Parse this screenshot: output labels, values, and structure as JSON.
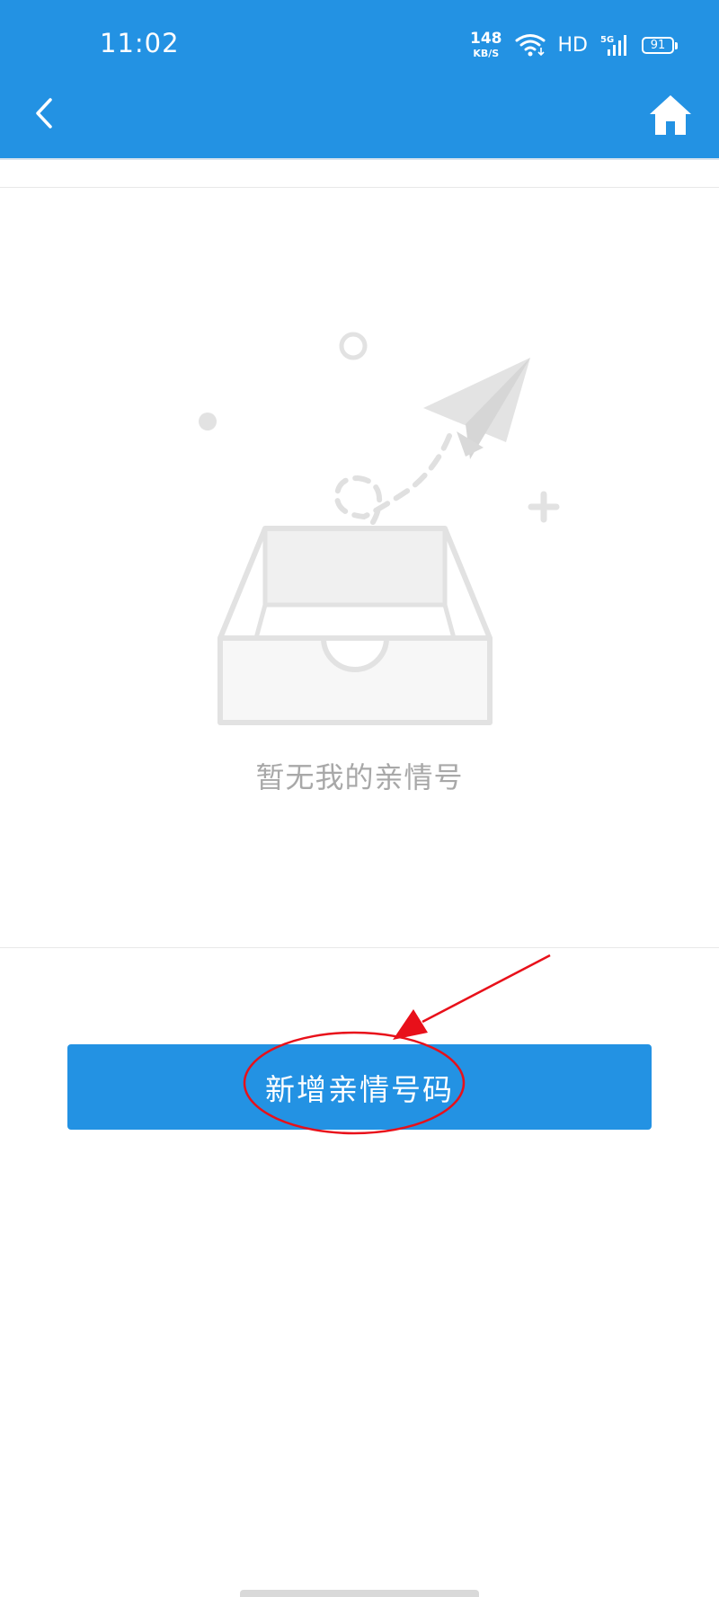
{
  "status_bar": {
    "time": "11:02",
    "net_speed_value": "148",
    "net_speed_unit": "KB/S",
    "hd_label": "HD",
    "network_type": "5G",
    "battery_level": "91"
  },
  "header": {
    "background_color": "#2392e3",
    "back_icon": "chevron-left-icon",
    "home_icon": "home-icon"
  },
  "empty_state": {
    "message": "暂无我的亲情号"
  },
  "actions": {
    "add_label": "新增亲情号码",
    "accent_color": "#2392e3"
  },
  "annotation": {
    "highlight_color": "#e8101a",
    "shapes": "ellipse-and-arrow"
  }
}
